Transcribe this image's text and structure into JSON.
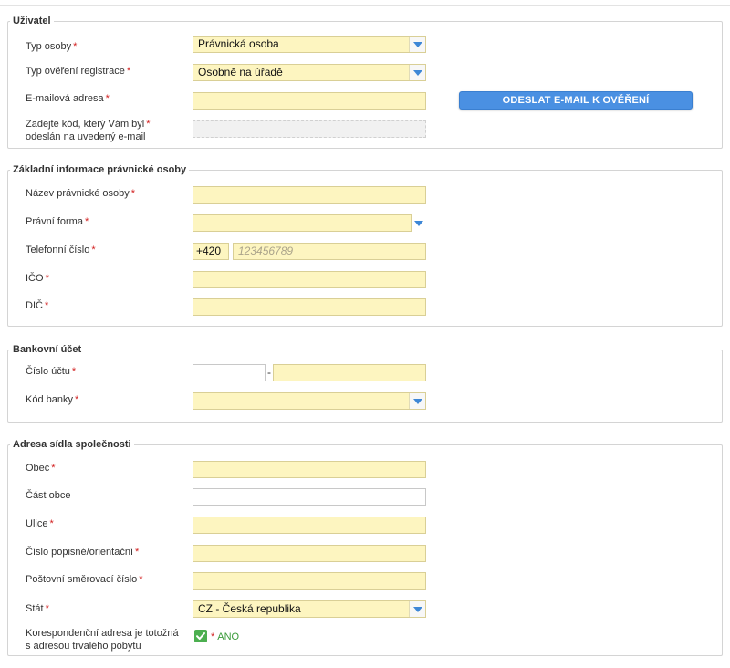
{
  "user": {
    "legend": "Uživatel",
    "person_type_label": "Typ osoby",
    "person_type_value": "Právnická osoba",
    "verification_label": "Typ ověření registrace",
    "verification_value": "Osobně na úřadě",
    "email_label": "E-mailová adresa",
    "email_value": "",
    "send_email_button": "ODESLAT E-MAIL K OVĚŘENÍ",
    "code_label_line1": "Zadejte kód, který Vám byl",
    "code_label_line2": "odeslán na uvedený e-mail",
    "code_value": ""
  },
  "entity": {
    "legend": "Základní informace právnické osoby",
    "name_label": "Název právnické osoby",
    "legal_form_label": "Právní forma",
    "phone_label": "Telefonní číslo",
    "phone_prefix": "+420",
    "phone_placeholder": "123456789",
    "ico_label": "IČO",
    "dic_label": "DIČ"
  },
  "bank": {
    "legend": "Bankovní účet",
    "account_label": "Číslo účtu",
    "account_separator": "-",
    "bank_code_label": "Kód banky"
  },
  "address": {
    "legend": "Adresa sídla společnosti",
    "city_label": "Obec",
    "city_part_label": "Část obce",
    "street_label": "Ulice",
    "house_number_label": "Číslo popisné/orientační",
    "postal_code_label": "Poštovní směrovací číslo",
    "country_label": "Stát",
    "country_value": "CZ - Česká republika",
    "correspondence_label_line1": "Korespondenční adresa je totožná",
    "correspondence_label_line2": "s adresou trvalého pobytu",
    "correspondence_checked_text": "ANO"
  },
  "required_marker": "*",
  "colors": {
    "field_bg": "#fdf5c0",
    "required": "#d21f1f",
    "button_bg": "#4a90e2",
    "arrow": "#3d87d6",
    "checkbox": "#4caf50"
  }
}
